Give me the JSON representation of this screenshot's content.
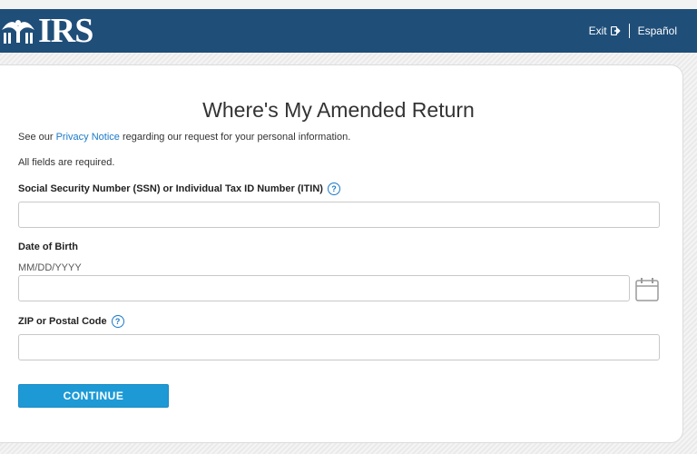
{
  "header": {
    "logo_text": "IRS",
    "exit_label": "Exit",
    "language_label": "Español"
  },
  "page": {
    "title": "Where's My Amended Return",
    "privacy_prefix": "See our ",
    "privacy_link": "Privacy Notice",
    "privacy_suffix": " regarding our request for your personal information.",
    "required_note": "All fields are required."
  },
  "form": {
    "ssn": {
      "label": "Social Security Number (SSN) or Individual Tax ID Number (ITIN)",
      "value": "",
      "help": "?"
    },
    "dob": {
      "label": "Date of Birth",
      "hint": "MM/DD/YYYY",
      "value": ""
    },
    "zip": {
      "label": "ZIP or Postal Code",
      "value": "",
      "help": "?"
    },
    "continue_label": "CONTINUE"
  },
  "colors": {
    "header_bg": "#1f4e79",
    "link": "#1b79c9",
    "button_bg": "#1d9ad6"
  }
}
